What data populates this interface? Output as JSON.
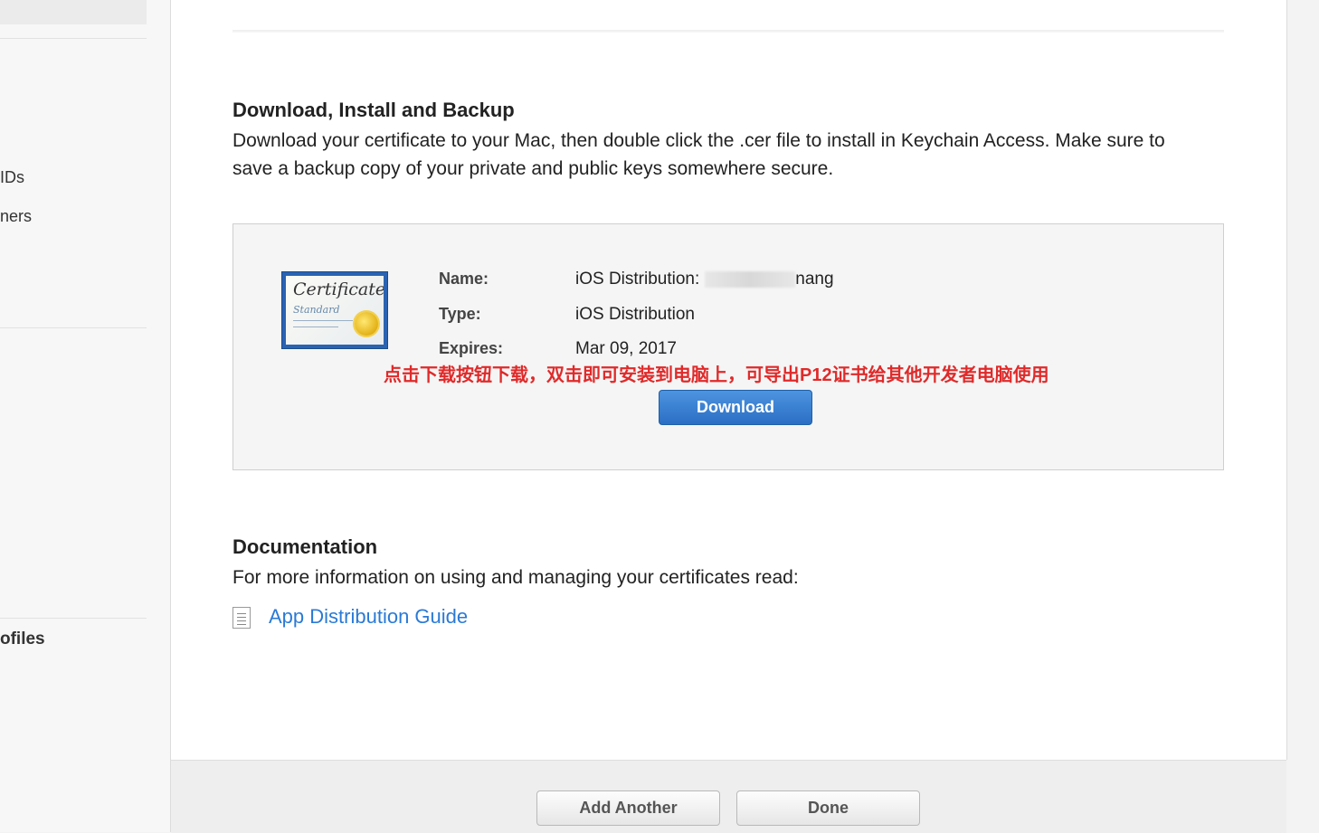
{
  "sidebar": {
    "items": [
      {
        "label": "IDs"
      },
      {
        "label": "ners"
      },
      {
        "label": "ofiles"
      }
    ]
  },
  "install_section": {
    "heading": "Download, Install and Backup",
    "description": "Download your certificate to your Mac, then double click the .cer file to install in Keychain Access. Make sure to save a backup copy of your private and public keys somewhere secure."
  },
  "certificate": {
    "icon_title": "Certificate",
    "icon_subtitle": "Standard",
    "name_label": "Name:",
    "name_value": "iOS Distribution:",
    "name_value_tail": "nang",
    "type_label": "Type:",
    "type_value": "iOS Distribution",
    "expires_label": "Expires:",
    "expires_value": "Mar 09, 2017",
    "annotation": "点击下载按钮下载，双击即可安装到电脑上，可导出P12证书给其他开发者电脑使用",
    "annotation_color": "#e02a2a",
    "download_label": "Download"
  },
  "documentation": {
    "heading": "Documentation",
    "description": "For more information on using and managing your certificates read:",
    "link_icon": "document-icon",
    "link_label": "App Distribution Guide"
  },
  "footer": {
    "add_another_label": "Add Another",
    "done_label": "Done"
  }
}
